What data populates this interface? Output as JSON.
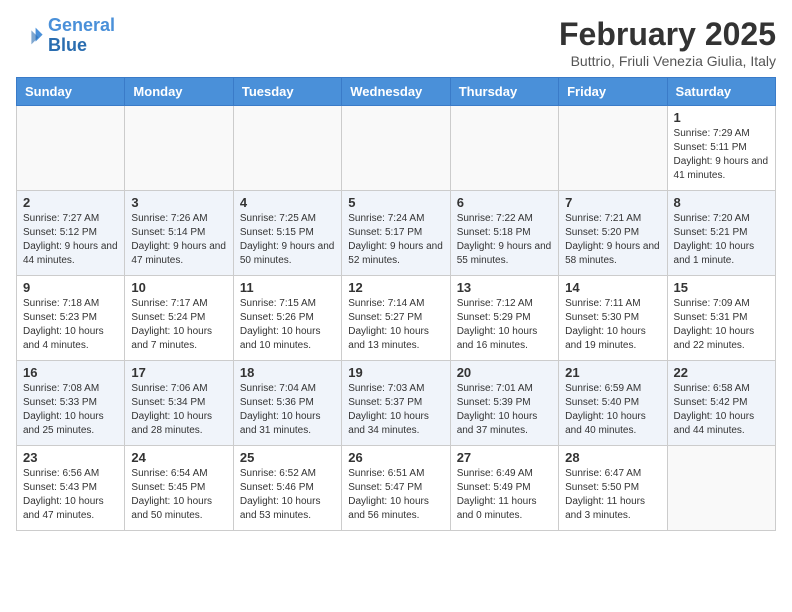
{
  "logo": {
    "line1": "General",
    "line2": "Blue"
  },
  "title": "February 2025",
  "subtitle": "Buttrio, Friuli Venezia Giulia, Italy",
  "weekdays": [
    "Sunday",
    "Monday",
    "Tuesday",
    "Wednesday",
    "Thursday",
    "Friday",
    "Saturday"
  ],
  "weeks": [
    [
      {
        "day": "",
        "info": ""
      },
      {
        "day": "",
        "info": ""
      },
      {
        "day": "",
        "info": ""
      },
      {
        "day": "",
        "info": ""
      },
      {
        "day": "",
        "info": ""
      },
      {
        "day": "",
        "info": ""
      },
      {
        "day": "1",
        "info": "Sunrise: 7:29 AM\nSunset: 5:11 PM\nDaylight: 9 hours and 41 minutes."
      }
    ],
    [
      {
        "day": "2",
        "info": "Sunrise: 7:27 AM\nSunset: 5:12 PM\nDaylight: 9 hours and 44 minutes."
      },
      {
        "day": "3",
        "info": "Sunrise: 7:26 AM\nSunset: 5:14 PM\nDaylight: 9 hours and 47 minutes."
      },
      {
        "day": "4",
        "info": "Sunrise: 7:25 AM\nSunset: 5:15 PM\nDaylight: 9 hours and 50 minutes."
      },
      {
        "day": "5",
        "info": "Sunrise: 7:24 AM\nSunset: 5:17 PM\nDaylight: 9 hours and 52 minutes."
      },
      {
        "day": "6",
        "info": "Sunrise: 7:22 AM\nSunset: 5:18 PM\nDaylight: 9 hours and 55 minutes."
      },
      {
        "day": "7",
        "info": "Sunrise: 7:21 AM\nSunset: 5:20 PM\nDaylight: 9 hours and 58 minutes."
      },
      {
        "day": "8",
        "info": "Sunrise: 7:20 AM\nSunset: 5:21 PM\nDaylight: 10 hours and 1 minute."
      }
    ],
    [
      {
        "day": "9",
        "info": "Sunrise: 7:18 AM\nSunset: 5:23 PM\nDaylight: 10 hours and 4 minutes."
      },
      {
        "day": "10",
        "info": "Sunrise: 7:17 AM\nSunset: 5:24 PM\nDaylight: 10 hours and 7 minutes."
      },
      {
        "day": "11",
        "info": "Sunrise: 7:15 AM\nSunset: 5:26 PM\nDaylight: 10 hours and 10 minutes."
      },
      {
        "day": "12",
        "info": "Sunrise: 7:14 AM\nSunset: 5:27 PM\nDaylight: 10 hours and 13 minutes."
      },
      {
        "day": "13",
        "info": "Sunrise: 7:12 AM\nSunset: 5:29 PM\nDaylight: 10 hours and 16 minutes."
      },
      {
        "day": "14",
        "info": "Sunrise: 7:11 AM\nSunset: 5:30 PM\nDaylight: 10 hours and 19 minutes."
      },
      {
        "day": "15",
        "info": "Sunrise: 7:09 AM\nSunset: 5:31 PM\nDaylight: 10 hours and 22 minutes."
      }
    ],
    [
      {
        "day": "16",
        "info": "Sunrise: 7:08 AM\nSunset: 5:33 PM\nDaylight: 10 hours and 25 minutes."
      },
      {
        "day": "17",
        "info": "Sunrise: 7:06 AM\nSunset: 5:34 PM\nDaylight: 10 hours and 28 minutes."
      },
      {
        "day": "18",
        "info": "Sunrise: 7:04 AM\nSunset: 5:36 PM\nDaylight: 10 hours and 31 minutes."
      },
      {
        "day": "19",
        "info": "Sunrise: 7:03 AM\nSunset: 5:37 PM\nDaylight: 10 hours and 34 minutes."
      },
      {
        "day": "20",
        "info": "Sunrise: 7:01 AM\nSunset: 5:39 PM\nDaylight: 10 hours and 37 minutes."
      },
      {
        "day": "21",
        "info": "Sunrise: 6:59 AM\nSunset: 5:40 PM\nDaylight: 10 hours and 40 minutes."
      },
      {
        "day": "22",
        "info": "Sunrise: 6:58 AM\nSunset: 5:42 PM\nDaylight: 10 hours and 44 minutes."
      }
    ],
    [
      {
        "day": "23",
        "info": "Sunrise: 6:56 AM\nSunset: 5:43 PM\nDaylight: 10 hours and 47 minutes."
      },
      {
        "day": "24",
        "info": "Sunrise: 6:54 AM\nSunset: 5:45 PM\nDaylight: 10 hours and 50 minutes."
      },
      {
        "day": "25",
        "info": "Sunrise: 6:52 AM\nSunset: 5:46 PM\nDaylight: 10 hours and 53 minutes."
      },
      {
        "day": "26",
        "info": "Sunrise: 6:51 AM\nSunset: 5:47 PM\nDaylight: 10 hours and 56 minutes."
      },
      {
        "day": "27",
        "info": "Sunrise: 6:49 AM\nSunset: 5:49 PM\nDaylight: 11 hours and 0 minutes."
      },
      {
        "day": "28",
        "info": "Sunrise: 6:47 AM\nSunset: 5:50 PM\nDaylight: 11 hours and 3 minutes."
      },
      {
        "day": "",
        "info": ""
      }
    ]
  ]
}
